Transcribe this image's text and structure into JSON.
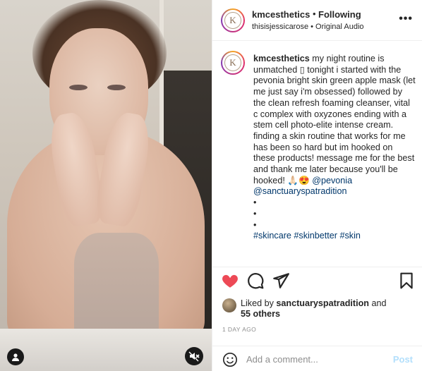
{
  "post": {
    "username": "kmcesthetics",
    "dot": "•",
    "follow_label": "Following",
    "subtitle": "thisisjessicarose • Original Audio",
    "more_label": "•••",
    "avatar_letter": "K"
  },
  "caption": {
    "username": "kmcesthetics",
    "body": " my night routine is unmatched ▯ tonight i started with the pevonia bright skin green apple mask (let me just say i'm obsessed) followed by the clean refresh foaming cleanser, vital c complex with oxyzones ending with a stem cell photo-elite intense cream. finding a skin routine that works for me has been so hard but im hooked on these products! message me for the best and thank me later because you'll be hooked! ",
    "emojis": "🙏🏻😍",
    "mention1": "@pevonia",
    "mention2": "@sanctuaryspatradition",
    "bullets": "•\n•\n•",
    "hashtags": "#skincare #skinbetter #skin"
  },
  "likes": {
    "prefix": "Liked by ",
    "liker": "sanctuaryspatradition",
    "connector": " and",
    "others": "55 others"
  },
  "timestamp": "1 DAY AGO",
  "comment": {
    "placeholder": "Add a comment...",
    "post_label": "Post"
  },
  "icons": {
    "like": "heart-icon",
    "comment": "comment-icon",
    "share": "send-icon",
    "save": "bookmark-icon",
    "emoji": "smiley-icon",
    "mute": "muted-speaker-icon",
    "tag": "person-tag-icon"
  },
  "colors": {
    "like_red": "#ed4956",
    "link_blue": "#00376b",
    "post_button": "#b2dffc",
    "meta_gray": "#8e8e8e"
  }
}
